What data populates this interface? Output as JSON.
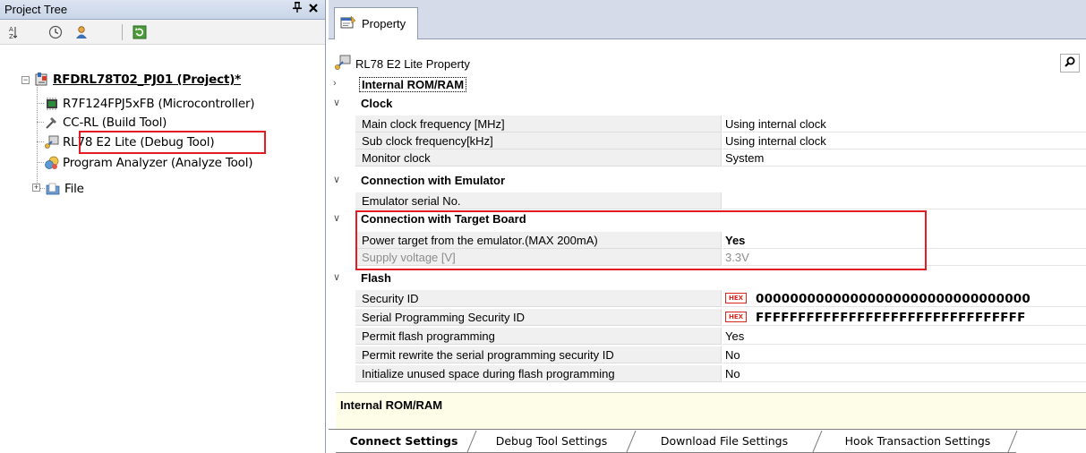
{
  "project_tree": {
    "title": "Project Tree",
    "pin_glyph": "⫪",
    "close_glyph": "✕",
    "toolbar": {
      "icons": [
        "sort-icon",
        "clock-icon",
        "user-icon",
        "refresh-icon"
      ]
    },
    "root": {
      "label": "RFDRL78T02_PJ01 (Project)*",
      "icon": "project-icon"
    },
    "items": [
      {
        "label": "R7F124FPJ5xFB (Microcontroller)",
        "icon": "microcontroller-icon"
      },
      {
        "label": "CC-RL (Build Tool)",
        "icon": "build-tool-icon"
      },
      {
        "label": "RL78 E2 Lite (Debug Tool)",
        "icon": "debug-tool-icon"
      },
      {
        "label": "Program Analyzer (Analyze Tool)",
        "icon": "analyzer-icon"
      },
      {
        "label": "File",
        "icon": "folder-icon"
      }
    ]
  },
  "property_panel": {
    "tab_label": "Property",
    "header_title": "RL78 E2 Lite Property",
    "categories": [
      {
        "label": "Internal ROM/RAM",
        "expanded": false,
        "chevron": "›"
      },
      {
        "label": "Clock",
        "expanded": true,
        "chevron": "∨",
        "props": [
          {
            "name": "Main clock frequency [MHz]",
            "value": "Using internal clock"
          },
          {
            "name": "Sub clock frequency[kHz]",
            "value": "Using internal clock"
          },
          {
            "name": "Monitor clock",
            "value": "System"
          }
        ]
      },
      {
        "label": "Connection with Emulator",
        "expanded": true,
        "chevron": "∨",
        "props": [
          {
            "name": "Emulator serial No.",
            "value": ""
          }
        ]
      },
      {
        "label": "Connection with Target Board",
        "expanded": true,
        "chevron": "∨",
        "props": [
          {
            "name": "Power target from the emulator.(MAX 200mA)",
            "value": "Yes"
          },
          {
            "name": "Supply voltage [V]",
            "value": "3.3V"
          }
        ]
      },
      {
        "label": "Flash",
        "expanded": true,
        "chevron": "∨",
        "props": [
          {
            "name": "Security ID",
            "value": "00000000000000000000000000000000",
            "badge": "HEX"
          },
          {
            "name": "Serial Programming Security ID",
            "value": "FFFFFFFFFFFFFFFFFFFFFFFFFFFFFFFF",
            "badge": "HEX"
          },
          {
            "name": "Permit flash programming",
            "value": "Yes"
          },
          {
            "name": "Permit rewrite the serial programming security ID",
            "value": "No"
          },
          {
            "name": "Initialize unused space during flash programming",
            "value": "No"
          }
        ]
      }
    ],
    "description_title": "Internal ROM/RAM",
    "bottom_tabs": [
      {
        "label": "Connect Settings",
        "active": true
      },
      {
        "label": "Debug Tool Settings",
        "active": false
      },
      {
        "label": "Download File Settings",
        "active": false
      },
      {
        "label": "Hook Transaction Settings",
        "active": false
      }
    ]
  },
  "colors": {
    "highlight": "#e31b23",
    "title_bar": "#c9d5e8",
    "desc_bg": "#fdfde8",
    "name_cell_bg": "#f0f0f0"
  }
}
